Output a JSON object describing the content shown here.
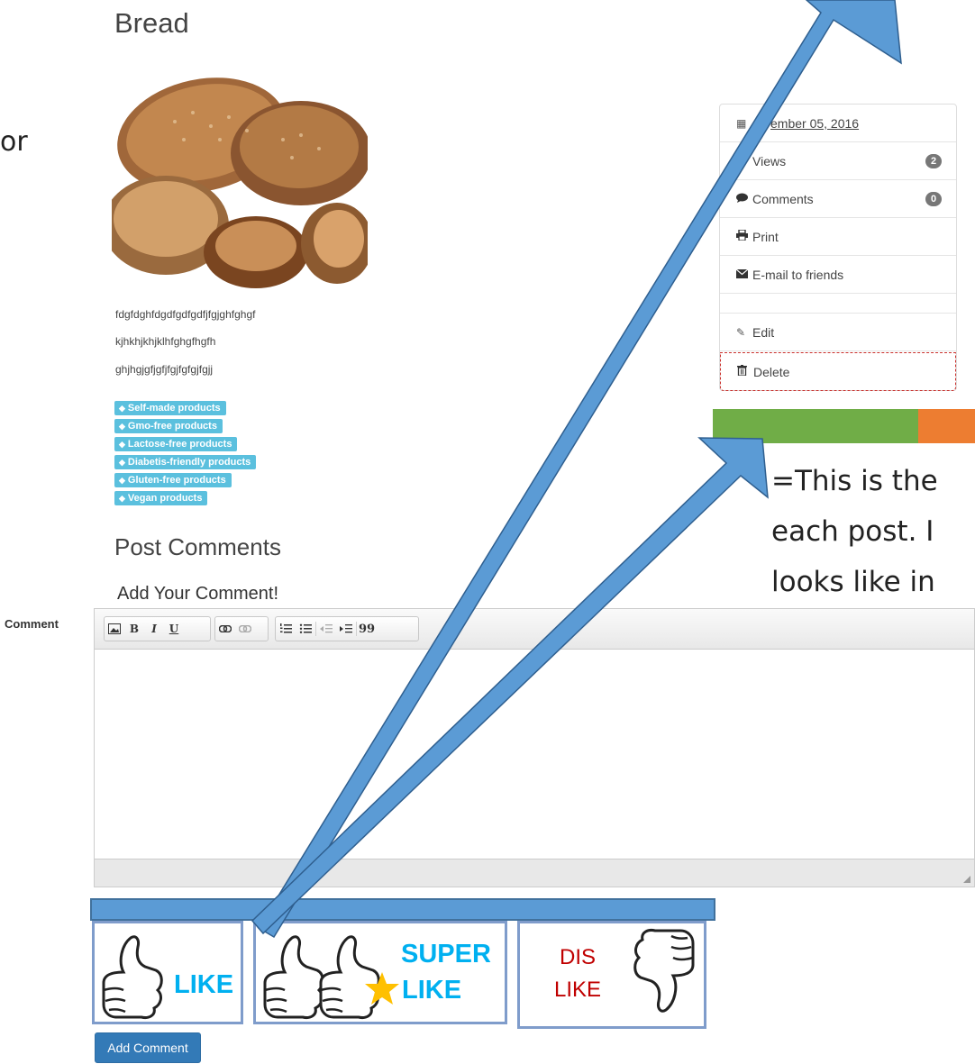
{
  "post": {
    "title": "Bread",
    "image_alt": "bread loaves",
    "body": [
      "fdgfdghfdgdfgdfgdfjfgjghfghgf",
      "kjhkhjkhjklhfghgfhgfh",
      "ghjhgjgfjgfjfgjfgfgjfgjj"
    ],
    "tags": [
      "Self-made products",
      "Gmo-free products",
      "Lactose-free products",
      "Diabetis-friendly products",
      "Gluten-free products",
      "Vegan products"
    ]
  },
  "left_cut_text": "or",
  "comments": {
    "heading": "Post Comments",
    "subheading": "Add Your Comment!",
    "field_label": "Comment",
    "submit_label": "Add Comment",
    "toolbar": {
      "bold": "B",
      "italic": "I",
      "underline": "U",
      "quote": "99"
    }
  },
  "info_panel": {
    "date": "ember 05, 2016",
    "views_label": "Views",
    "views_count": "2",
    "comments_label": "Comments",
    "comments_count": "0",
    "print_label": "Print",
    "email_label": "E-mail to friends",
    "edit_label": "Edit",
    "delete_label": "Delete"
  },
  "annotation": {
    "line1": "=This is the",
    "line2": "each post. I",
    "line3": "looks like in"
  },
  "reactions": {
    "like": "LIKE",
    "super_line1": "SUPER",
    "super_line2": "LIKE",
    "dislike_line1": "DIS",
    "dislike_line2": "LIKE"
  },
  "rating_bar": {
    "green_fraction": 0.78,
    "orange_fraction": 0.22
  },
  "colors": {
    "tag": "#5bc0de",
    "primary_button": "#337ab7",
    "arrow": "#5b9bd5",
    "bar_green": "#70ad47",
    "bar_orange": "#ed7d31",
    "like_text": "#00b0f0",
    "dislike_text": "#c00000"
  }
}
